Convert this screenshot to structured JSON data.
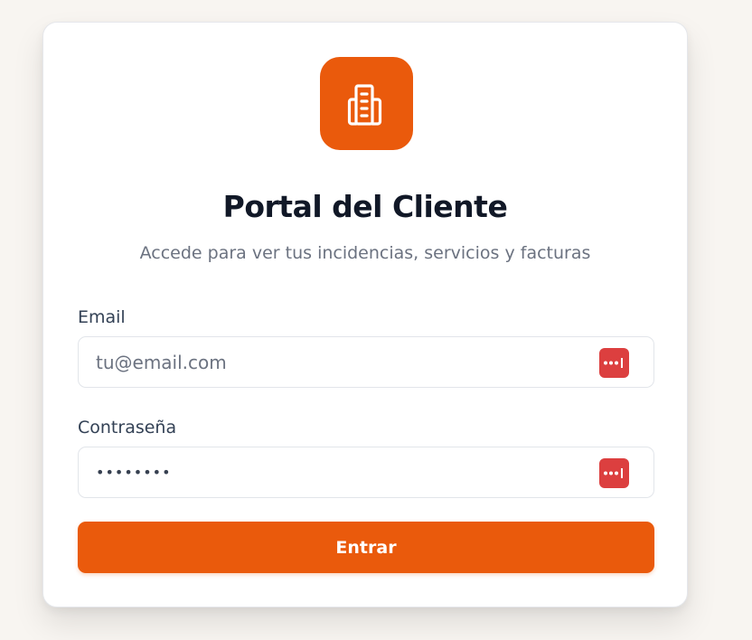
{
  "login": {
    "title": "Portal del Cliente",
    "subtitle": "Accede para ver tus incidencias, servicios y facturas",
    "email_label": "Email",
    "email_placeholder": "tu@email.com",
    "password_label": "Contraseña",
    "password_value": "••••••••",
    "submit_label": "Entrar"
  },
  "icons": {
    "logo": "building-icon",
    "password_manager": "password-manager-icon"
  },
  "colors": {
    "accent": "#ea5a0c",
    "password_manager": "#dc3f3f",
    "title": "#111827",
    "subtitle": "#6b7280",
    "background": "#f8f5f1"
  }
}
